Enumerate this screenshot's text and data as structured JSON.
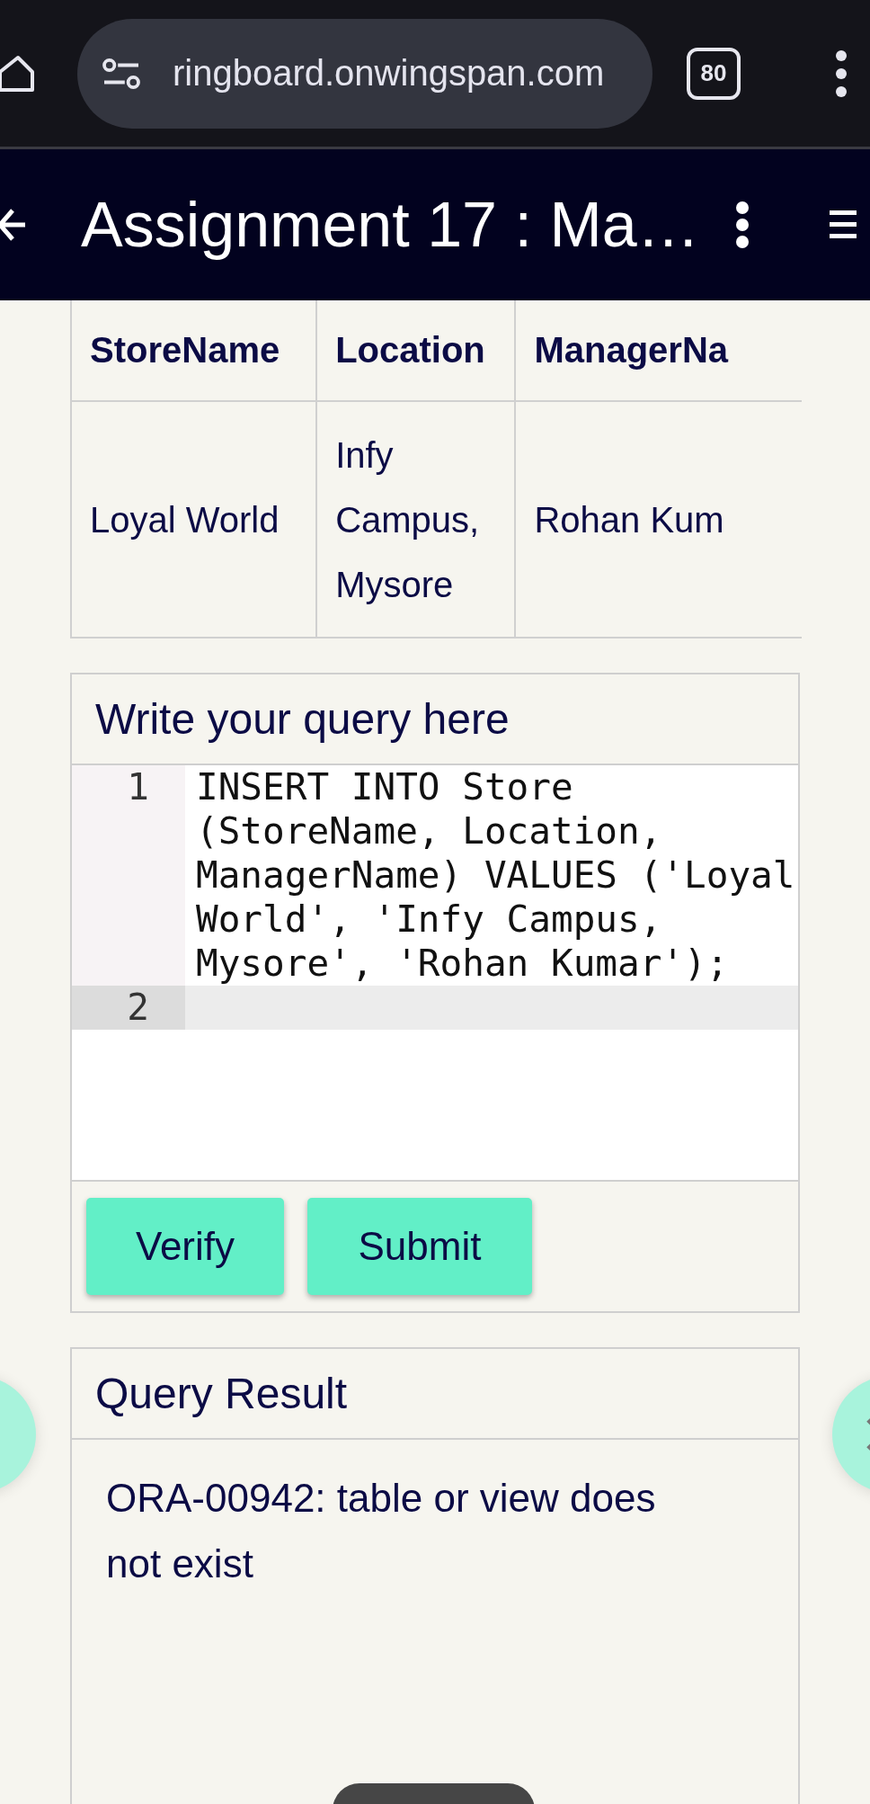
{
  "browser": {
    "url": "ringboard.onwingspan.com",
    "tab_count": "80"
  },
  "app_bar": {
    "title": "Assignment 17 : Ma…"
  },
  "table": {
    "columns": [
      "StoreName",
      "Location",
      "ManagerNa"
    ],
    "rows": [
      [
        "Loyal World",
        "Infy Campus, Mysore",
        "Rohan Kum"
      ]
    ]
  },
  "editor": {
    "title": "Write your query here",
    "lines": [
      {
        "number": "1",
        "text": "INSERT INTO Store (StoreName, Location, ManagerName) VALUES ('Loyal World', 'Infy Campus, Mysore', 'Rohan Kumar');",
        "current": false
      },
      {
        "number": "2",
        "current": true
      }
    ],
    "buttons": [
      "Verify",
      "Submit"
    ]
  },
  "result": {
    "title": "Query Result",
    "message": "ORA-00942: table or view does not exist"
  }
}
